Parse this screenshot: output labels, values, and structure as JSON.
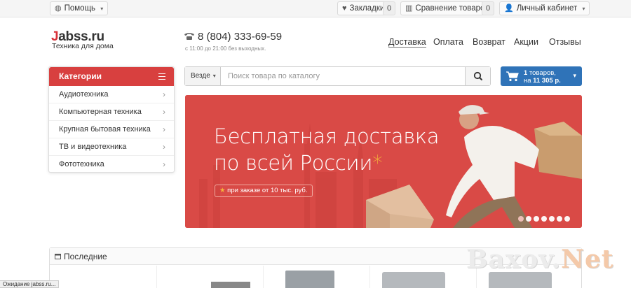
{
  "topbar": {
    "help_label": "Помощь",
    "bookmarks_label": "Закладки",
    "bookmarks_count": "0",
    "compare_label": "Сравнение товаров",
    "compare_count": "0",
    "account_label": "Личный кабинет"
  },
  "header": {
    "logo_initial": "J",
    "logo_rest": "abss.ru",
    "tagline": "Техника для дома",
    "phone": "8 (804) 333-69-59",
    "hours": "с 11:00 до 21:00 без выходных."
  },
  "nav": {
    "items": [
      {
        "label": "Доставка"
      },
      {
        "label": "Оплата"
      },
      {
        "label": "Возврат"
      },
      {
        "label": "Акции"
      },
      {
        "label": "Отзывы"
      }
    ]
  },
  "categories": {
    "title": "Категории",
    "items": [
      {
        "label": "Аудиотехника"
      },
      {
        "label": "Компьютерная техника"
      },
      {
        "label": "Крупная бытовая техника"
      },
      {
        "label": "ТВ и видеотехника"
      },
      {
        "label": "Фототехника"
      }
    ]
  },
  "search": {
    "scope": "Везде",
    "placeholder": "Поиск товара по каталогу"
  },
  "cart": {
    "count": "1",
    "count_suffix": "товаров,",
    "prefix": "на",
    "total": "11 305 р."
  },
  "banner": {
    "line1": "Бесплатная доставка",
    "line2": "по всей России",
    "star": "*",
    "note_star": "★",
    "note": "при заказе от 10 тыс. руб.",
    "slide_count": 7,
    "active_slide": 0
  },
  "latest": {
    "title": "Последние"
  },
  "status_bar": "Ожидание jabss.ru...",
  "watermark": {
    "part1": "Baxov.",
    "part2": "Net"
  },
  "colors": {
    "accent_red": "#d8403f",
    "banner_red": "#d94a46",
    "cart_blue": "#2f73b8",
    "star_yellow": "#f5b73a"
  }
}
